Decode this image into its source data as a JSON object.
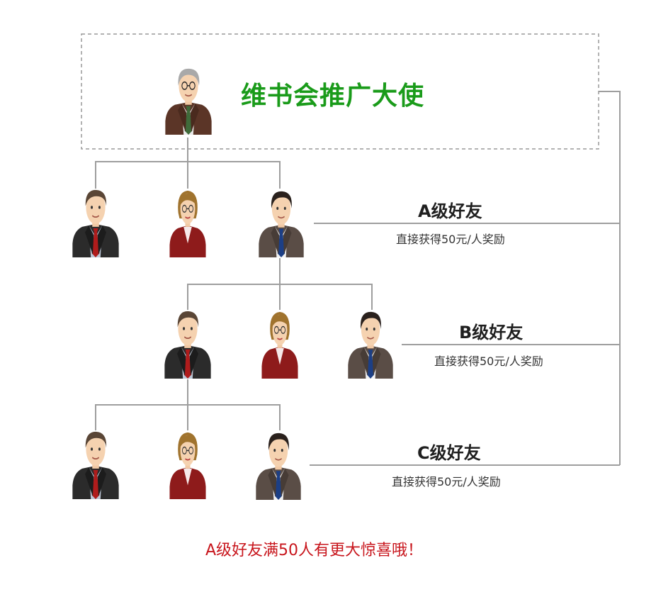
{
  "top": {
    "title": "维书会推广大使",
    "accent_color": "#1a9b1a"
  },
  "levels": [
    {
      "title": "A级好友",
      "subtitle": "直接获得50元/人奖励"
    },
    {
      "title": "B级好友",
      "subtitle": "直接获得50元/人奖励"
    },
    {
      "title": "C级好友",
      "subtitle": "直接获得50元/人奖励"
    }
  ],
  "footer": {
    "text": "A级好友满50人有更大惊喜哦！",
    "color": "#c8161d"
  },
  "icons": {
    "ambassador": "elderly-man-avatar-icon",
    "man_dark_suit": "man-dark-suit-avatar-icon",
    "woman": "woman-glasses-avatar-icon",
    "man_brown_suit": "man-brown-suit-avatar-icon"
  }
}
